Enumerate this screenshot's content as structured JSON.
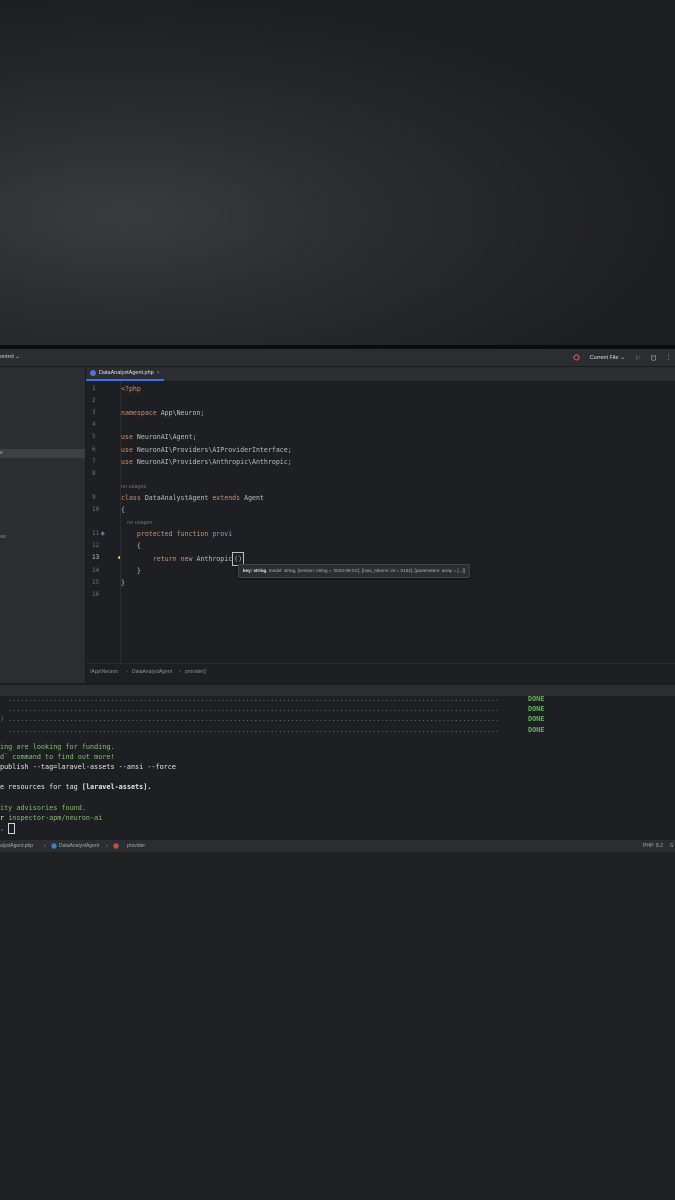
{
  "titlebar": {
    "left_label": "ontrol ⌄",
    "run_config": "Current File",
    "icons": [
      "copilot-icon",
      "run-icon",
      "debug-icon",
      "more-icon"
    ]
  },
  "sidebar": {
    "selected_label": "e"
  },
  "editor": {
    "tab_label": "DataAnalystAgent.php",
    "lines": [
      {
        "n": "1",
        "tokens": [
          {
            "t": "<?php",
            "c": "c-kw"
          }
        ]
      },
      {
        "n": "2",
        "tokens": []
      },
      {
        "n": "3",
        "tokens": [
          {
            "t": "namespace ",
            "c": "c-kw"
          },
          {
            "t": "App\\Neuron;",
            "c": "c-id"
          }
        ]
      },
      {
        "n": "4",
        "tokens": []
      },
      {
        "n": "5",
        "tokens": [
          {
            "t": "use ",
            "c": "c-kw"
          },
          {
            "t": "NeuronAI\\Agent;",
            "c": "c-id"
          }
        ]
      },
      {
        "n": "6",
        "tokens": [
          {
            "t": "use ",
            "c": "c-kw"
          },
          {
            "t": "NeuronAI\\Providers\\AIProviderInterface;",
            "c": "c-id"
          }
        ]
      },
      {
        "n": "7",
        "tokens": [
          {
            "t": "use ",
            "c": "c-kw"
          },
          {
            "t": "NeuronAI\\Providers\\Anthropic\\Anthropic;",
            "c": "c-id"
          }
        ]
      },
      {
        "n": "8",
        "tokens": []
      },
      {
        "n": "",
        "tokens": [
          {
            "t": "no usages",
            "c": "c-hint"
          }
        ]
      },
      {
        "n": "9",
        "tokens": [
          {
            "t": "class ",
            "c": "c-kw"
          },
          {
            "t": "DataAnalystAgent ",
            "c": "c-id"
          },
          {
            "t": "extends ",
            "c": "c-kw"
          },
          {
            "t": "Agent",
            "c": "c-id"
          }
        ]
      },
      {
        "n": "10",
        "tokens": [
          {
            "t": "{",
            "c": "c-id"
          }
        ]
      },
      {
        "n": "",
        "tokens": [
          {
            "t": "    no usages",
            "c": "c-hint"
          }
        ]
      },
      {
        "n": "11",
        "tokens": [
          {
            "t": "    protected function ",
            "c": "c-kw"
          },
          {
            "t": "provi",
            "c": "c-fn"
          }
        ]
      },
      {
        "n": "12",
        "tokens": [
          {
            "t": "    {",
            "c": "c-id"
          }
        ]
      },
      {
        "n": "13",
        "tokens": [
          {
            "t": "        return new ",
            "c": "c-kw"
          },
          {
            "t": "Anthropic",
            "c": "c-id"
          }
        ]
      },
      {
        "n": "14",
        "tokens": [
          {
            "t": "    }",
            "c": "c-id"
          }
        ]
      },
      {
        "n": "15",
        "tokens": [
          {
            "t": "}",
            "c": "c-id"
          }
        ]
      },
      {
        "n": "16",
        "tokens": []
      }
    ],
    "caret_text": "()",
    "tooltip": {
      "key": "key: string",
      "rest": ", model: string, [version: string = '2023-06-01'], [max_tokens: int = 8192], [parameters: array = [...]]"
    },
    "breadcrumb": [
      "\\App\\Neuron",
      "DataAnalystAgent",
      "provider()"
    ]
  },
  "terminal": {
    "dots_lines": [
      {
        "prefix": " ",
        "status": "DONE"
      },
      {
        "prefix": " ",
        "status": "DONE"
      },
      {
        "prefix": ")",
        "status": "DONE"
      },
      {
        "prefix": " ",
        "status": "DONE"
      }
    ],
    "funding_line": "ing are looking for funding.",
    "fund_cmd_line": "d` command to find out more!",
    "publish_cmd": "publish --tag=laravel-assets --ansi --force",
    "resources_text": "e resources for tag ",
    "resources_tag": "[laravel-assets].",
    "advisories": "ity advisories found.",
    "package_prefix": "r ",
    "package_name": "inspector-apm/neuron-ai"
  },
  "statusbar": {
    "path": [
      "alystAgent.php",
      "DataAnalystAgent",
      "provider"
    ],
    "php_version": "PHP: 8.2",
    "extra": "S"
  }
}
